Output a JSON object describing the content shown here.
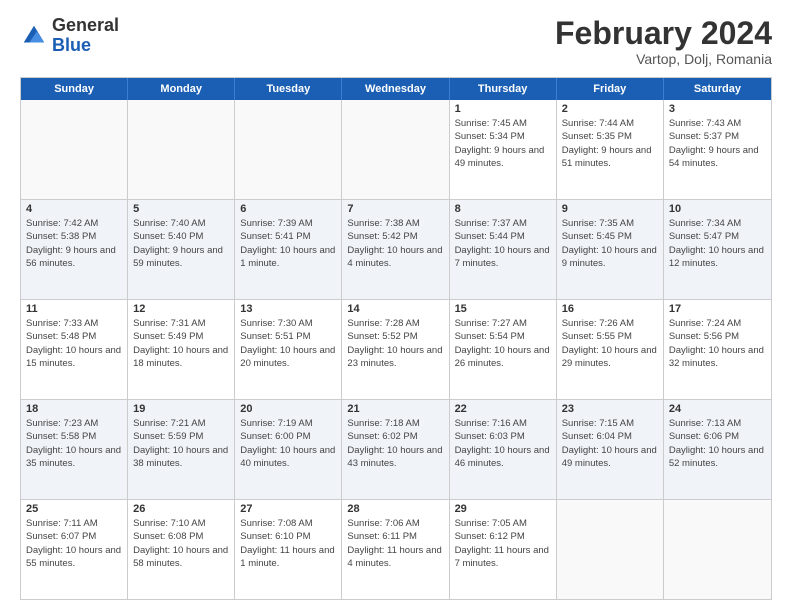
{
  "header": {
    "logo": {
      "general": "General",
      "blue": "Blue"
    },
    "title": "February 2024",
    "location": "Vartop, Dolj, Romania"
  },
  "weekdays": [
    "Sunday",
    "Monday",
    "Tuesday",
    "Wednesday",
    "Thursday",
    "Friday",
    "Saturday"
  ],
  "weeks": [
    [
      {
        "day": "",
        "sunrise": "",
        "sunset": "",
        "daylight": ""
      },
      {
        "day": "",
        "sunrise": "",
        "sunset": "",
        "daylight": ""
      },
      {
        "day": "",
        "sunrise": "",
        "sunset": "",
        "daylight": ""
      },
      {
        "day": "",
        "sunrise": "",
        "sunset": "",
        "daylight": ""
      },
      {
        "day": "1",
        "sunrise": "Sunrise: 7:45 AM",
        "sunset": "Sunset: 5:34 PM",
        "daylight": "Daylight: 9 hours and 49 minutes."
      },
      {
        "day": "2",
        "sunrise": "Sunrise: 7:44 AM",
        "sunset": "Sunset: 5:35 PM",
        "daylight": "Daylight: 9 hours and 51 minutes."
      },
      {
        "day": "3",
        "sunrise": "Sunrise: 7:43 AM",
        "sunset": "Sunset: 5:37 PM",
        "daylight": "Daylight: 9 hours and 54 minutes."
      }
    ],
    [
      {
        "day": "4",
        "sunrise": "Sunrise: 7:42 AM",
        "sunset": "Sunset: 5:38 PM",
        "daylight": "Daylight: 9 hours and 56 minutes."
      },
      {
        "day": "5",
        "sunrise": "Sunrise: 7:40 AM",
        "sunset": "Sunset: 5:40 PM",
        "daylight": "Daylight: 9 hours and 59 minutes."
      },
      {
        "day": "6",
        "sunrise": "Sunrise: 7:39 AM",
        "sunset": "Sunset: 5:41 PM",
        "daylight": "Daylight: 10 hours and 1 minute."
      },
      {
        "day": "7",
        "sunrise": "Sunrise: 7:38 AM",
        "sunset": "Sunset: 5:42 PM",
        "daylight": "Daylight: 10 hours and 4 minutes."
      },
      {
        "day": "8",
        "sunrise": "Sunrise: 7:37 AM",
        "sunset": "Sunset: 5:44 PM",
        "daylight": "Daylight: 10 hours and 7 minutes."
      },
      {
        "day": "9",
        "sunrise": "Sunrise: 7:35 AM",
        "sunset": "Sunset: 5:45 PM",
        "daylight": "Daylight: 10 hours and 9 minutes."
      },
      {
        "day": "10",
        "sunrise": "Sunrise: 7:34 AM",
        "sunset": "Sunset: 5:47 PM",
        "daylight": "Daylight: 10 hours and 12 minutes."
      }
    ],
    [
      {
        "day": "11",
        "sunrise": "Sunrise: 7:33 AM",
        "sunset": "Sunset: 5:48 PM",
        "daylight": "Daylight: 10 hours and 15 minutes."
      },
      {
        "day": "12",
        "sunrise": "Sunrise: 7:31 AM",
        "sunset": "Sunset: 5:49 PM",
        "daylight": "Daylight: 10 hours and 18 minutes."
      },
      {
        "day": "13",
        "sunrise": "Sunrise: 7:30 AM",
        "sunset": "Sunset: 5:51 PM",
        "daylight": "Daylight: 10 hours and 20 minutes."
      },
      {
        "day": "14",
        "sunrise": "Sunrise: 7:28 AM",
        "sunset": "Sunset: 5:52 PM",
        "daylight": "Daylight: 10 hours and 23 minutes."
      },
      {
        "day": "15",
        "sunrise": "Sunrise: 7:27 AM",
        "sunset": "Sunset: 5:54 PM",
        "daylight": "Daylight: 10 hours and 26 minutes."
      },
      {
        "day": "16",
        "sunrise": "Sunrise: 7:26 AM",
        "sunset": "Sunset: 5:55 PM",
        "daylight": "Daylight: 10 hours and 29 minutes."
      },
      {
        "day": "17",
        "sunrise": "Sunrise: 7:24 AM",
        "sunset": "Sunset: 5:56 PM",
        "daylight": "Daylight: 10 hours and 32 minutes."
      }
    ],
    [
      {
        "day": "18",
        "sunrise": "Sunrise: 7:23 AM",
        "sunset": "Sunset: 5:58 PM",
        "daylight": "Daylight: 10 hours and 35 minutes."
      },
      {
        "day": "19",
        "sunrise": "Sunrise: 7:21 AM",
        "sunset": "Sunset: 5:59 PM",
        "daylight": "Daylight: 10 hours and 38 minutes."
      },
      {
        "day": "20",
        "sunrise": "Sunrise: 7:19 AM",
        "sunset": "Sunset: 6:00 PM",
        "daylight": "Daylight: 10 hours and 40 minutes."
      },
      {
        "day": "21",
        "sunrise": "Sunrise: 7:18 AM",
        "sunset": "Sunset: 6:02 PM",
        "daylight": "Daylight: 10 hours and 43 minutes."
      },
      {
        "day": "22",
        "sunrise": "Sunrise: 7:16 AM",
        "sunset": "Sunset: 6:03 PM",
        "daylight": "Daylight: 10 hours and 46 minutes."
      },
      {
        "day": "23",
        "sunrise": "Sunrise: 7:15 AM",
        "sunset": "Sunset: 6:04 PM",
        "daylight": "Daylight: 10 hours and 49 minutes."
      },
      {
        "day": "24",
        "sunrise": "Sunrise: 7:13 AM",
        "sunset": "Sunset: 6:06 PM",
        "daylight": "Daylight: 10 hours and 52 minutes."
      }
    ],
    [
      {
        "day": "25",
        "sunrise": "Sunrise: 7:11 AM",
        "sunset": "Sunset: 6:07 PM",
        "daylight": "Daylight: 10 hours and 55 minutes."
      },
      {
        "day": "26",
        "sunrise": "Sunrise: 7:10 AM",
        "sunset": "Sunset: 6:08 PM",
        "daylight": "Daylight: 10 hours and 58 minutes."
      },
      {
        "day": "27",
        "sunrise": "Sunrise: 7:08 AM",
        "sunset": "Sunset: 6:10 PM",
        "daylight": "Daylight: 11 hours and 1 minute."
      },
      {
        "day": "28",
        "sunrise": "Sunrise: 7:06 AM",
        "sunset": "Sunset: 6:11 PM",
        "daylight": "Daylight: 11 hours and 4 minutes."
      },
      {
        "day": "29",
        "sunrise": "Sunrise: 7:05 AM",
        "sunset": "Sunset: 6:12 PM",
        "daylight": "Daylight: 11 hours and 7 minutes."
      },
      {
        "day": "",
        "sunrise": "",
        "sunset": "",
        "daylight": ""
      },
      {
        "day": "",
        "sunrise": "",
        "sunset": "",
        "daylight": ""
      }
    ]
  ]
}
